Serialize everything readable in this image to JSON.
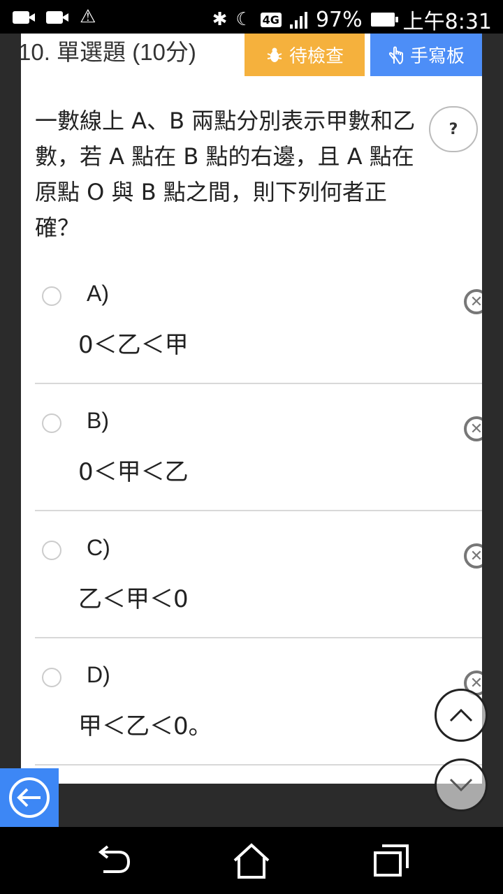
{
  "status_bar": {
    "network": "4G",
    "battery": "97%",
    "time": "上午8:31"
  },
  "question": {
    "number_type": "10.  單選題 (10分)",
    "check_button": "待檢查",
    "handwriting_button": "手寫板",
    "help_label": "?",
    "text": "一數線上 A、B 兩點分別表示甲數和乙數，若 A 點在 B 點的右邊，且 A 點在原點 O 與 B 點之間，則下列何者正確？"
  },
  "options": [
    {
      "label": "A)",
      "text": "0＜乙＜甲"
    },
    {
      "label": "B)",
      "text": "0＜甲＜乙"
    },
    {
      "label": "C)",
      "text": "乙＜甲＜0"
    },
    {
      "label": "D)",
      "text": "甲＜乙＜0。"
    }
  ],
  "colors": {
    "check_button": "#f5b13d",
    "handwriting_button": "#4d8ef7",
    "back_button": "#3d87f5"
  }
}
